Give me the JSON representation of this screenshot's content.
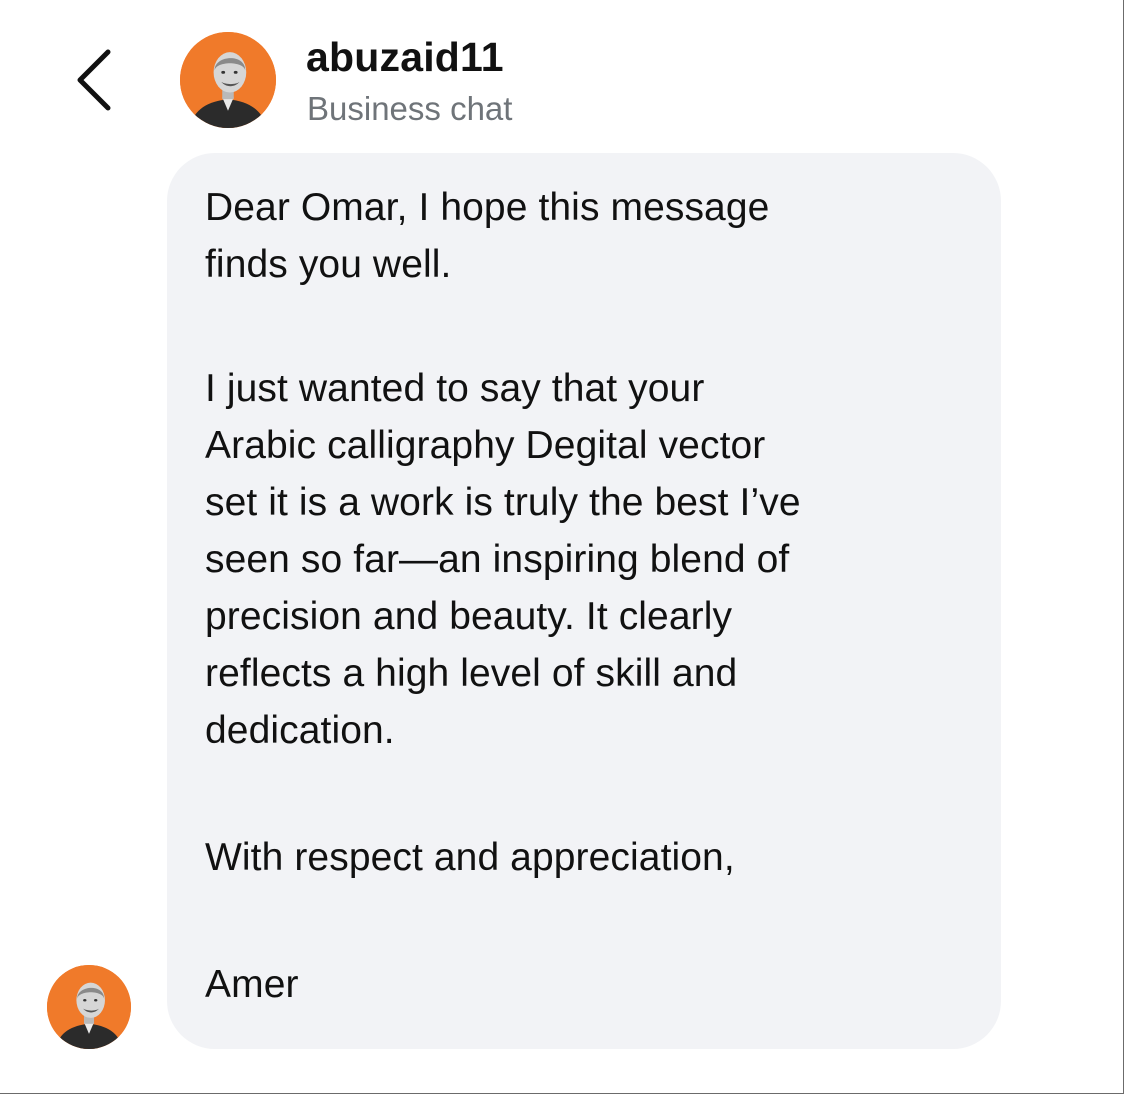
{
  "header": {
    "username": "abuzaid11",
    "subtitle": "Business chat"
  },
  "icons": {
    "back": "chevron-left-icon",
    "avatar": "profile-photo"
  },
  "colors": {
    "avatar_background": "#f07a2a",
    "bubble_background": "#f2f3f6",
    "subtitle_text": "#6f7479"
  },
  "message": {
    "lines": [
      "Dear Omar, I hope this message",
      "finds you well.",
      "I just wanted to say that your",
      "Arabic calligraphy Degital vector",
      "set it is a work is truly the best I’ve",
      "seen so far—an inspiring blend of",
      "precision and beauty. It clearly",
      "reflects a high level of skill and",
      "dedication.",
      "With respect and appreciation,",
      "Amer"
    ]
  }
}
